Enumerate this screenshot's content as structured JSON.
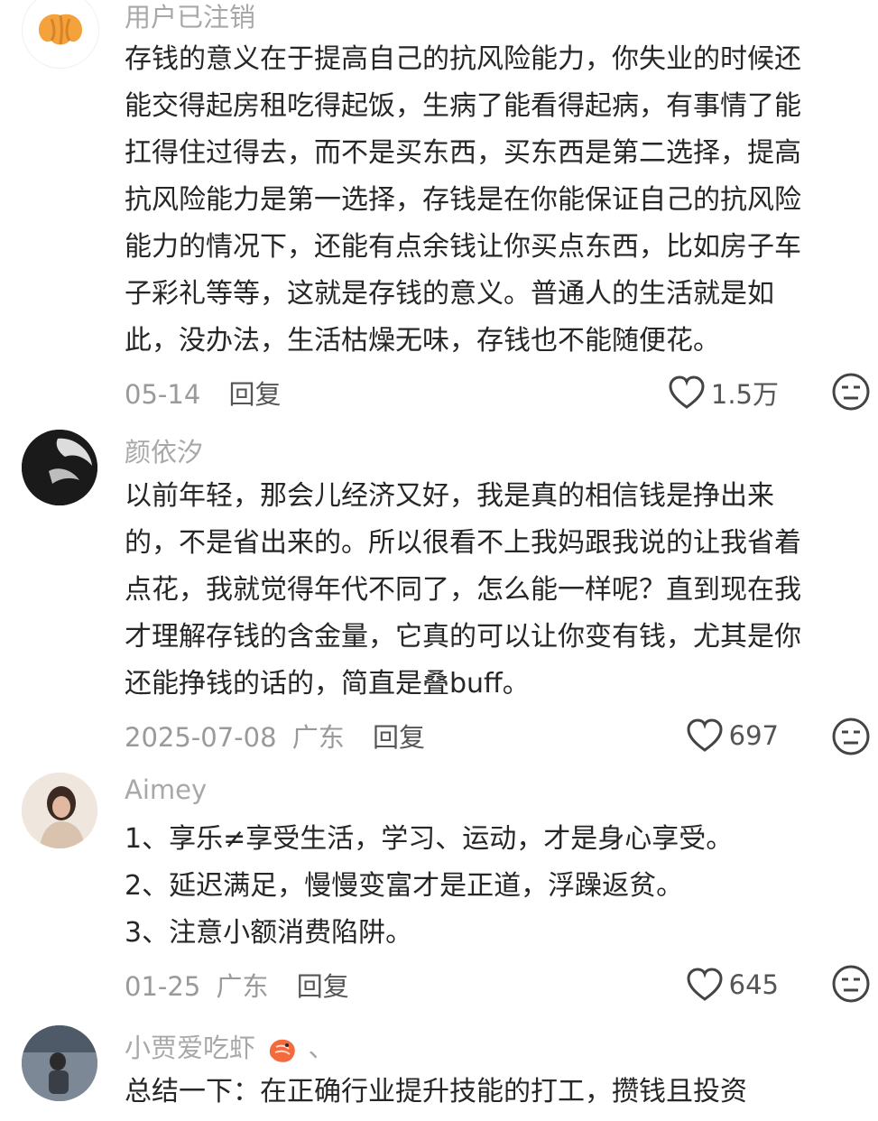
{
  "comments": [
    {
      "username": "用户已注销",
      "lines": [
        "存钱的意义在于提高自己的抗风险能力，你失业的时候还",
        "能交得起房租吃得起饭，生病了能看得起病，有事情了能",
        "扛得住过得去，而不是买东西，买东西是第二选择，提高",
        "抗风险能力是第一选择，存钱是在你能保证自己的抗风险",
        "能力的情况下，还能有点余钱让你买点东西，比如房子车",
        "子彩礼等等，这就是存钱的意义。普通人的生活就是如",
        "此，没办法，生活枯燥无味，存钱也不能随便花。"
      ],
      "date": "05-14",
      "location": "",
      "reply_label": "回复",
      "likes": "1.5万",
      "avatar_icon": "croissant-icon"
    },
    {
      "username": "颜依汐",
      "lines": [
        "以前年轻，那会儿经济又好，我是真的相信钱是挣出来",
        "的，不是省出来的。所以很看不上我妈跟我说的让我省着",
        "点花，我就觉得年代不同了，怎么能一样呢？直到现在我",
        "才理解存钱的含金量，它真的可以让你变有钱，尤其是你",
        "还能挣钱的话的，简直是叠buff。"
      ],
      "date": "2025-07-08",
      "location": "广东",
      "reply_label": "回复",
      "likes": "697",
      "avatar_icon": "dark-photo-avatar"
    },
    {
      "username": "Aimey",
      "lines": [
        "1、享乐≠享受生活，学习、运动，才是身心享受。",
        "2、延迟满足，慢慢变富才是正道，浮躁返贫。",
        "3、注意小额消费陷阱。"
      ],
      "date": "01-25",
      "location": "广东",
      "reply_label": "回复",
      "likes": "645",
      "avatar_icon": "portrait-avatar"
    },
    {
      "username": "小贾爱吃虾",
      "username_suffix": "、",
      "lines": [
        "总结一下：在正确行业提升技能的打工，攒钱且投资"
      ],
      "avatar_icon": "photo-avatar"
    }
  ],
  "colors": {
    "meta_gray": "#9a9a9a",
    "username_gray": "#a8a8a8",
    "text": "#262626"
  }
}
